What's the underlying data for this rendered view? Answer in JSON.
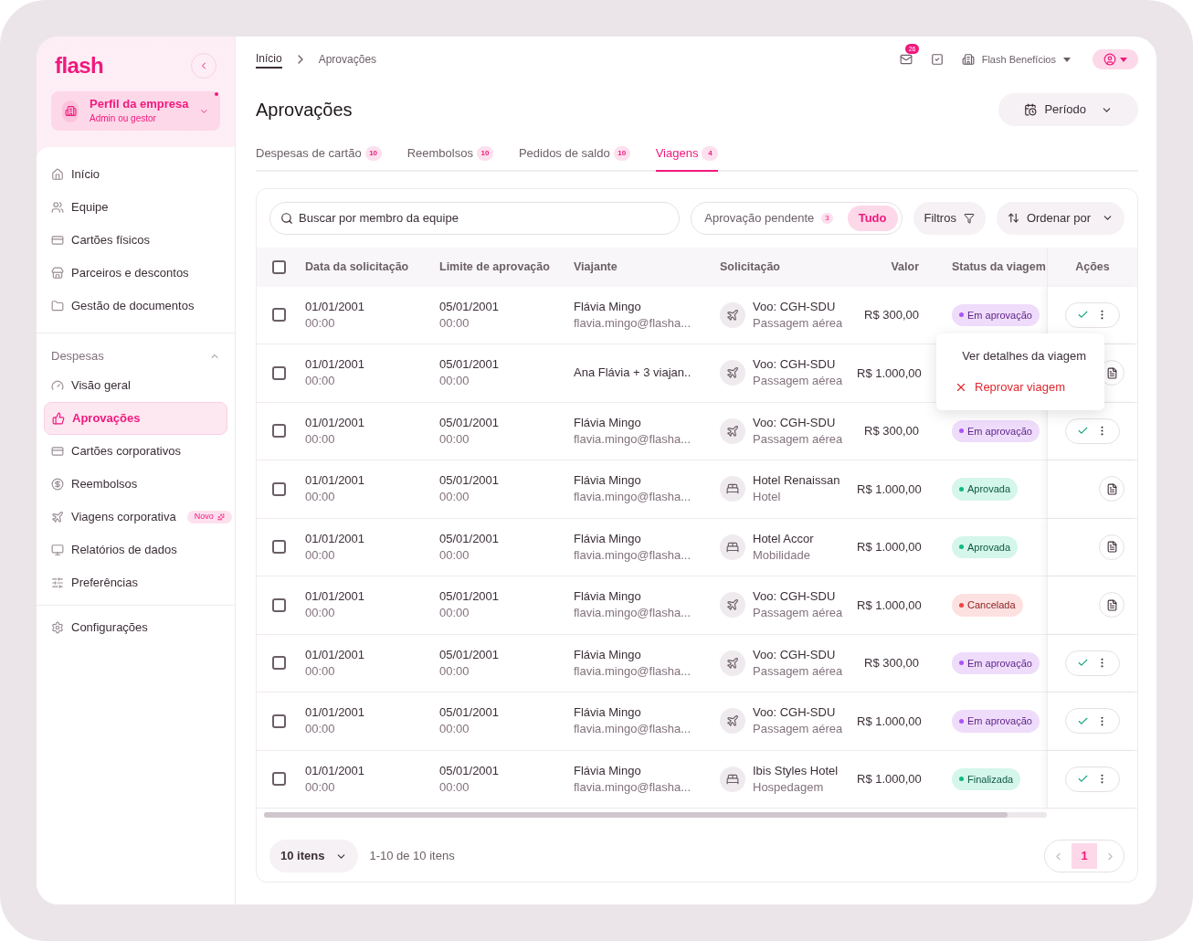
{
  "sidebar": {
    "logo": "flash",
    "profile": {
      "title": "Perfil da empresa",
      "subtitle": "Admin ou gestor",
      "notification": true
    },
    "items": [
      {
        "label": "Início",
        "selected": false
      },
      {
        "label": "Equipe",
        "selected": false
      },
      {
        "label": "Cartões físicos",
        "selected": false
      },
      {
        "label": "Parceiros e descontos",
        "selected": false
      },
      {
        "label": "Gestão de documentos",
        "selected": false
      }
    ],
    "section": {
      "title": "Despesas",
      "expanded": true,
      "items": [
        {
          "label": "Visão geral",
          "selected": false
        },
        {
          "label": "Aprovações",
          "selected": true
        },
        {
          "label": "Cartões corporativos",
          "selected": false
        },
        {
          "label": "Reembolsos",
          "selected": false
        },
        {
          "label": "Viagens corporativa",
          "selected": false,
          "badge": "Novo"
        },
        {
          "label": "Relatórios de dados",
          "selected": false
        },
        {
          "label": "Preferências",
          "selected": false
        }
      ]
    },
    "footer_items": [
      {
        "label": "Configurações",
        "selected": false
      }
    ]
  },
  "breadcrumb": [
    "Início",
    "Aprovações"
  ],
  "topbar": {
    "mail_count": "26",
    "company": "Flash Benefícios"
  },
  "page_title": "Aprovações",
  "period_button": "Período",
  "tabs": [
    {
      "label": "Despesas de cartão",
      "count": "10",
      "selected": false
    },
    {
      "label": "Reembolsos",
      "count": "10",
      "selected": false
    },
    {
      "label": "Pedidos de saldo",
      "count": "10",
      "selected": false
    },
    {
      "label": "Viagens",
      "count": "4",
      "selected": true
    }
  ],
  "toolbar": {
    "search_placeholder": "Buscar por membro da equipe",
    "segments": [
      {
        "label": "Aprovação pendente",
        "count": "3",
        "selected": false
      },
      {
        "label": "Tudo",
        "selected": true
      }
    ],
    "filters": "Filtros",
    "sort": "Ordenar por"
  },
  "table": {
    "columns": [
      "Data da solicitação",
      "Limite de aprovação",
      "Viajante",
      "Solicitação",
      "Valor",
      "Status da viagem",
      "Ações"
    ],
    "select_all_checked": false,
    "rows": [
      {
        "checked": false,
        "date": "01/01/2001",
        "date_time": "00:00",
        "limit": "05/01/2001",
        "limit_time": "00:00",
        "traveler": "Flávia Mingo",
        "email": "flavia.mingo@flasha...",
        "request": {
          "kind": "flight",
          "title": "Voo: CGH-SDU",
          "type": "Passagem aérea"
        },
        "value": "R$ 300,00",
        "status": {
          "kind": "pending",
          "label": "Em aprovação",
          "color": "#a855f7"
        },
        "actions": {
          "kind": "approve"
        }
      },
      {
        "checked": false,
        "date": "01/01/2001",
        "date_time": "00:00",
        "limit": "05/01/2001",
        "limit_time": "00:00",
        "traveler": "Ana Flávia + 3 viajan..",
        "request": {
          "kind": "flight",
          "title": "Voo: CGH-SDU",
          "type": "Passagem aérea"
        },
        "value": "R$ 1.000,00",
        "actions": {
          "kind": "document"
        }
      },
      {
        "checked": false,
        "date": "01/01/2001",
        "date_time": "00:00",
        "limit": "05/01/2001",
        "limit_time": "00:00",
        "traveler": "Flávia Mingo",
        "email": "flavia.mingo@flasha...",
        "request": {
          "kind": "flight",
          "title": "Voo: CGH-SDU",
          "type": "Passagem aérea"
        },
        "value": "R$ 300,00",
        "status": {
          "kind": "pending",
          "label": "Em aprovação",
          "color": "#a855f7"
        },
        "actions": {
          "kind": "approve"
        }
      },
      {
        "checked": false,
        "date": "01/01/2001",
        "date_time": "00:00",
        "limit": "05/01/2001",
        "limit_time": "00:00",
        "traveler": "Flávia Mingo",
        "email": "flavia.mingo@flasha...",
        "request": {
          "kind": "hotel",
          "title": "Hotel Renaissan",
          "type": "Hotel"
        },
        "value": "R$ 1.000,00",
        "status": {
          "kind": "approved",
          "label": "Aprovada",
          "color": "#10b981"
        },
        "actions": {
          "kind": "document"
        }
      },
      {
        "checked": false,
        "date": "01/01/2001",
        "date_time": "00:00",
        "limit": "05/01/2001",
        "limit_time": "00:00",
        "traveler": "Flávia Mingo",
        "email": "flavia.mingo@flasha...",
        "request": {
          "kind": "hotel",
          "title": "Hotel Accor",
          "type": "Mobilidade"
        },
        "value": "R$ 1.000,00",
        "status": {
          "kind": "approved",
          "label": "Aprovada",
          "color": "#10b981"
        },
        "actions": {
          "kind": "document"
        }
      },
      {
        "checked": false,
        "date": "01/01/2001",
        "date_time": "00:00",
        "limit": "05/01/2001",
        "limit_time": "00:00",
        "traveler": "Flávia Mingo",
        "email": "flavia.mingo@flasha...",
        "request": {
          "kind": "flight",
          "title": "Voo: CGH-SDU",
          "type": "Passagem aérea"
        },
        "value": "R$ 1.000,00",
        "status": {
          "kind": "cancelled",
          "label": "Cancelada",
          "color": "#ef4444"
        },
        "actions": {
          "kind": "document"
        }
      },
      {
        "checked": false,
        "date": "01/01/2001",
        "date_time": "00:00",
        "limit": "05/01/2001",
        "limit_time": "00:00",
        "traveler": "Flávia Mingo",
        "email": "flavia.mingo@flasha...",
        "request": {
          "kind": "flight",
          "title": "Voo: CGH-SDU",
          "type": "Passagem aérea"
        },
        "value": "R$ 300,00",
        "status": {
          "kind": "pending",
          "label": "Em aprovação",
          "color": "#a855f7"
        },
        "actions": {
          "kind": "approve"
        }
      },
      {
        "checked": false,
        "date": "01/01/2001",
        "date_time": "00:00",
        "limit": "05/01/2001",
        "limit_time": "00:00",
        "traveler": "Flávia Mingo",
        "email": "flavia.mingo@flasha...",
        "request": {
          "kind": "flight",
          "title": "Voo: CGH-SDU",
          "type": "Passagem aérea"
        },
        "value": "R$ 1.000,00",
        "status": {
          "kind": "pending",
          "label": "Em aprovação",
          "color": "#a855f7"
        },
        "actions": {
          "kind": "approve"
        }
      },
      {
        "checked": false,
        "date": "01/01/2001",
        "date_time": "00:00",
        "limit": "05/01/2001",
        "limit_time": "00:00",
        "traveler": "Flávia Mingo",
        "email": "flavia.mingo@flasha...",
        "request": {
          "kind": "hotel",
          "title": "Ibis Styles Hotel",
          "type": "Hospedagem"
        },
        "value": "R$ 1.000,00",
        "status": {
          "kind": "finished",
          "label": "Finalizada",
          "color": "#10b981"
        },
        "actions": {
          "kind": "approve"
        }
      }
    ]
  },
  "row_menu": {
    "items": [
      {
        "kind": "details",
        "label": "Ver detalhes da viagem"
      },
      {
        "kind": "reject",
        "label": "Reprovar viagem"
      }
    ]
  },
  "pagination": {
    "page_size": "10 itens",
    "range": "1-10 de 10 itens",
    "pages": [
      {
        "label": "1",
        "selected": true
      }
    ]
  }
}
